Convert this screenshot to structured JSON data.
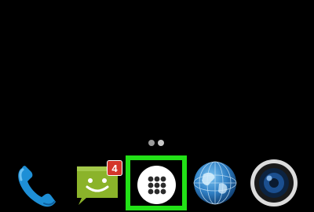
{
  "home_screen": {
    "page_indicator": {
      "dots": [
        {
          "state": "active",
          "color": "#9a9a9a"
        },
        {
          "state": "inactive",
          "color": "#c8c8c8"
        }
      ]
    }
  },
  "dock": {
    "items": [
      {
        "name": "phone",
        "icon": "phone-handset-icon",
        "color": "#1e8fd6"
      },
      {
        "name": "messaging",
        "icon": "smiley-speech-bubble-icon",
        "color": "#8bb32a",
        "badge": "4",
        "badge_color": "#d4352a"
      },
      {
        "name": "app-drawer",
        "icon": "grid-dots-icon",
        "highlight_color": "#22e117"
      },
      {
        "name": "browser",
        "icon": "globe-icon",
        "color": "#3a8fd1"
      },
      {
        "name": "camera",
        "icon": "camera-lens-icon",
        "color": "#1b4f8f"
      }
    ]
  }
}
